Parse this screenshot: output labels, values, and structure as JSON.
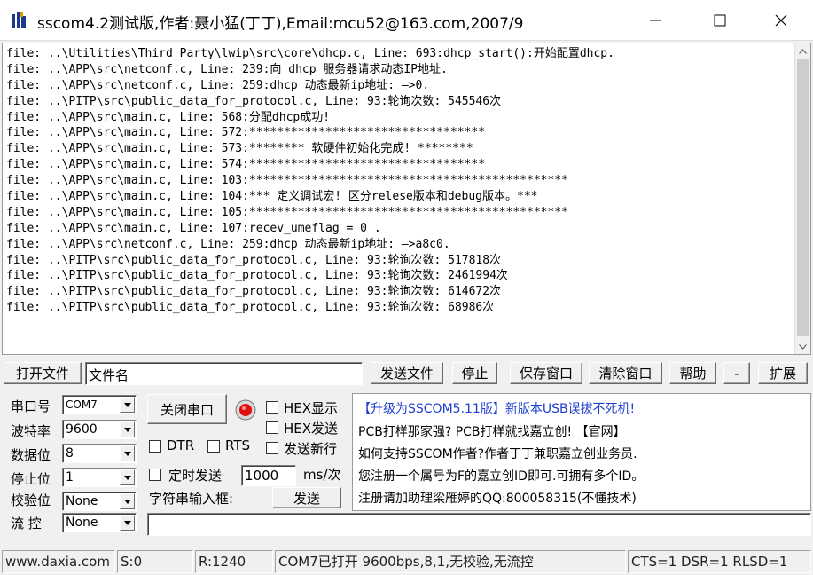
{
  "window": {
    "title": "sscom4.2测试版,作者:聂小猛(丁丁),Email:mcu52@163.com,2007/9",
    "icon": "tools-app-icon",
    "controls": [
      "minimize-icon",
      "maximize-icon",
      "close-icon"
    ]
  },
  "log": {
    "lines": [
      "file: ..\\Utilities\\Third_Party\\lwip\\src\\core\\dhcp.c, Line: 693:dhcp_start():开始配置dhcp.",
      "file: ..\\APP\\src\\netconf.c, Line: 239:向 dhcp 服务器请求动态IP地址.",
      "file: ..\\APP\\src\\netconf.c, Line: 259:dhcp 动态最新ip地址: —>0.",
      "file: ..\\PITP\\src\\public_data_for_protocol.c, Line: 93:轮询次数: 545546次",
      "file: ..\\APP\\src\\main.c, Line: 568:分配dhcp成功!",
      "file: ..\\APP\\src\\main.c, Line: 572:**********************************",
      "file: ..\\APP\\src\\main.c, Line: 573:******** 软硬件初始化完成! ********",
      "file: ..\\APP\\src\\main.c, Line: 574:**********************************",
      "file: ..\\APP\\src\\main.c, Line: 103:**********************************************",
      "file: ..\\APP\\src\\main.c, Line: 104:*** 定义调试宏! 区分relese版本和debug版本。***",
      "file: ..\\APP\\src\\main.c, Line: 105:**********************************************",
      "file: ..\\APP\\src\\main.c, Line: 107:recev_umeflag = 0 .",
      "file: ..\\APP\\src\\netconf.c, Line: 259:dhcp 动态最新ip地址: —>a8c0.",
      "file: ..\\PITP\\src\\public_data_for_protocol.c, Line: 93:轮询次数: 517818次",
      "file: ..\\PITP\\src\\public_data_for_protocol.c, Line: 93:轮询次数: 2461994次",
      "file: ..\\PITP\\src\\public_data_for_protocol.c, Line: 93:轮询次数: 614672次",
      "file: ..\\PITP\\src\\public_data_for_protocol.c, Line: 93:轮询次数: 68986次"
    ]
  },
  "toolbar": {
    "open_file": "打开文件",
    "filename_value": "文件名",
    "send_file": "发送文件",
    "stop": "停止",
    "save_window": "保存窗口",
    "clear_window": "清除窗口",
    "help": "帮助",
    "collapse": "-",
    "expand": "扩展"
  },
  "settings": {
    "port_label": "串口号",
    "port_value": "COM7",
    "baud_label": "波特率",
    "baud_value": "9600",
    "databits_label": "数据位",
    "databits_value": "8",
    "stopbits_label": "停止位",
    "stopbits_value": "1",
    "parity_label": "校验位",
    "parity_value": "None",
    "flow_label": "流 控",
    "flow_value": "None"
  },
  "controls": {
    "close_port": "关闭串口",
    "hex_display": "HEX显示",
    "hex_send": "HEX发送",
    "send_newline": "发送新行",
    "dtr": "DTR",
    "rts": "RTS",
    "timed_send": "定时发送",
    "interval_value": "1000",
    "interval_unit": "ms/次",
    "string_input_label": "字符串输入框:",
    "send": "发送",
    "send_input_value": ""
  },
  "ad": {
    "lines": [
      "【升级为SSCOM5.11版】新版本USB误拔不死机!",
      "PCB打样那家强? PCB打样就找嘉立创! 【官网】",
      "如何支持SSCOM作者?作者丁丁兼职嘉立创业务员.",
      "您注册一个属号为F的嘉立创ID即可.可拥有多个ID。",
      "注册请加助理梁雁婷的QQ:800058315(不懂技术)"
    ],
    "link_color": "#1f3fd0"
  },
  "status": {
    "website": "www.daxia.com",
    "sent": "S:0",
    "received": "R:1240",
    "port_status": "COM7已打开  9600bps,8,1,无校验,无流控",
    "signals": "CTS=1 DSR=1 RLSD=1"
  }
}
